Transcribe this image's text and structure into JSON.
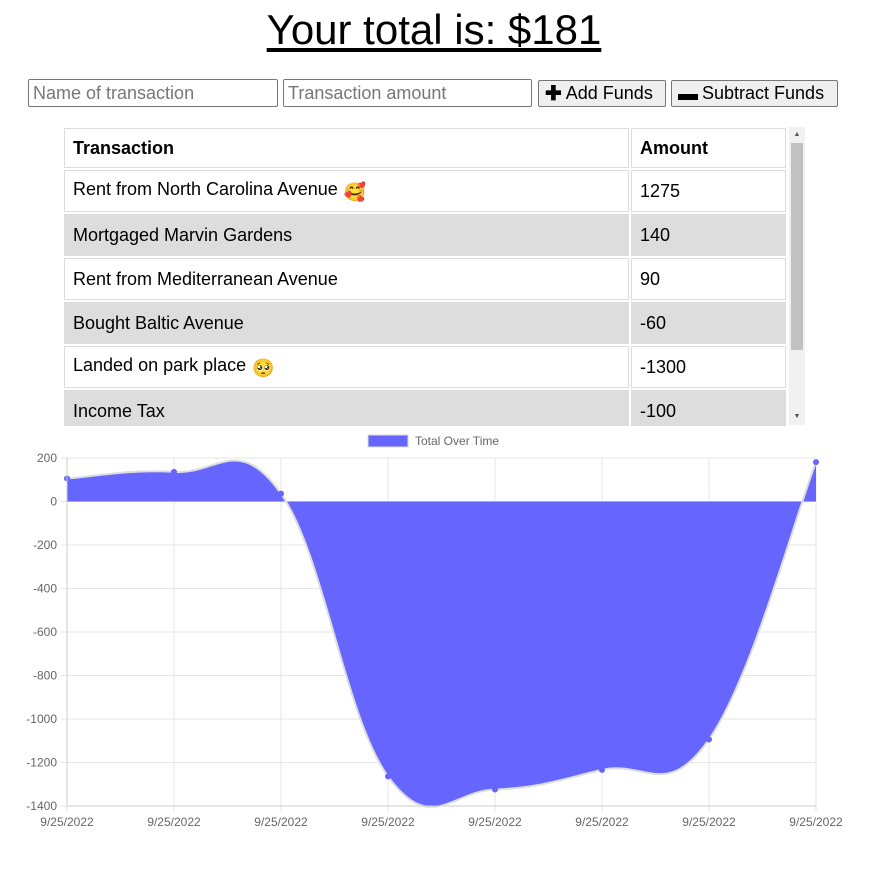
{
  "header": {
    "total_text": "Your total is: $181"
  },
  "form": {
    "name_placeholder": "Name of transaction",
    "amount_placeholder": "Transaction amount",
    "add_label": "Add Funds",
    "subtract_label": "Subtract Funds"
  },
  "table": {
    "headers": [
      "Transaction",
      "Amount"
    ],
    "rows": [
      {
        "name": "Rent from North Carolina Avenue",
        "amount": "1275",
        "emoji": "🥰"
      },
      {
        "name": "Mortgaged Marvin Gardens",
        "amount": "140"
      },
      {
        "name": "Rent from Mediterranean Avenue",
        "amount": "90"
      },
      {
        "name": "Bought Baltic Avenue",
        "amount": "-60"
      },
      {
        "name": "Landed on park place",
        "amount": "-1300",
        "emoji": "🥺"
      },
      {
        "name": "Income Tax",
        "amount": "-100"
      }
    ]
  },
  "colors": {
    "area_fill": "#6666ff",
    "area_line": "#dddddd",
    "grid": "#e5e5e5",
    "row_shade": "#dddddd"
  },
  "chart_data": {
    "type": "area",
    "legend": "Total Over Time",
    "legend_position": "top-center",
    "grid": true,
    "x": [
      "9/25/2022",
      "9/25/2022",
      "9/25/2022",
      "9/25/2022",
      "9/25/2022",
      "9/25/2022",
      "9/25/2022",
      "9/25/2022"
    ],
    "values": [
      106,
      136,
      36,
      -1264,
      -1324,
      -1234,
      -1094,
      181
    ],
    "ylim": [
      -1400,
      200
    ],
    "yticks": [
      200,
      0,
      -200,
      -400,
      -600,
      -800,
      -1000,
      -1200,
      -1400
    ]
  }
}
